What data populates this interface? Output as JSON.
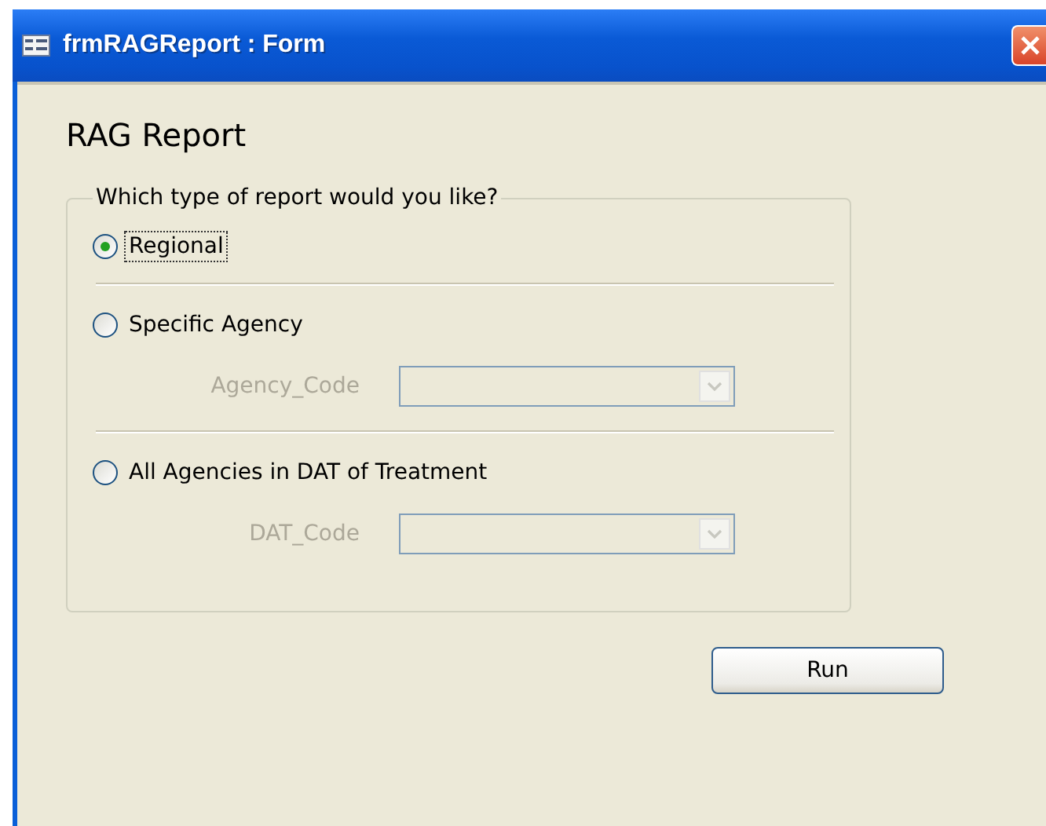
{
  "window": {
    "title": "frmRAGReport : Form"
  },
  "heading": "RAG Report",
  "group": {
    "legend": "Which type of report would you like?",
    "options": [
      {
        "label": "Regional",
        "selected": true,
        "focused": true
      },
      {
        "label": "Specific Agency",
        "selected": false,
        "focused": false,
        "field": {
          "label": "Agency_Code",
          "disabled": true
        }
      },
      {
        "label": "All Agencies in DAT of Treatment",
        "selected": false,
        "focused": false,
        "field": {
          "label": "DAT_Code",
          "disabled": true
        }
      }
    ]
  },
  "buttons": [
    "Run"
  ]
}
